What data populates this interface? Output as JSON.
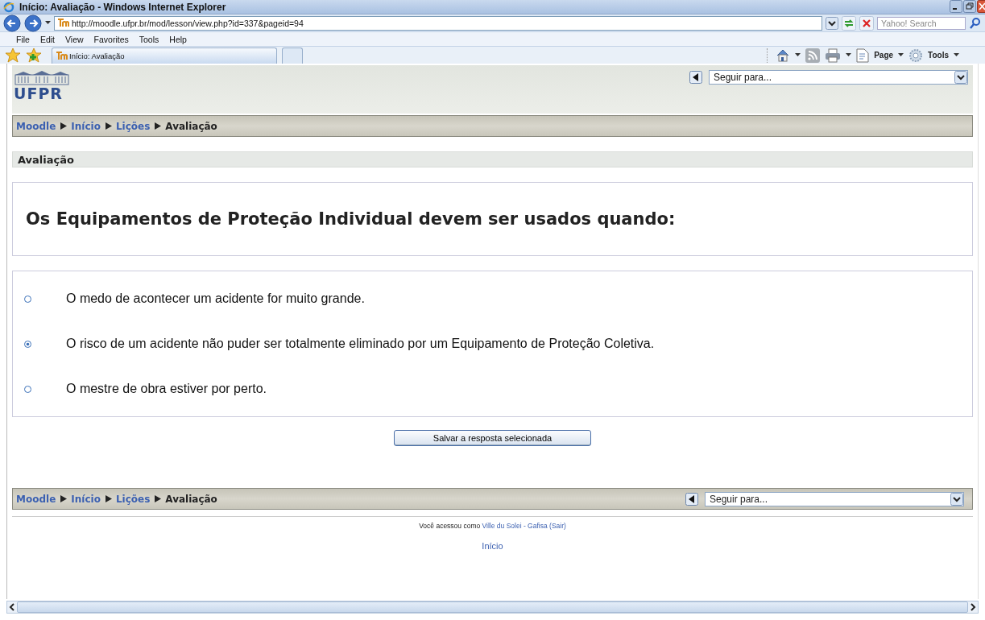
{
  "window": {
    "title": "Início: Avaliação - Windows Internet Explorer"
  },
  "address_bar": {
    "url": "http://moodle.ufpr.br/mod/lesson/view.php?id=337&pageid=94"
  },
  "search": {
    "placeholder": "Yahoo! Search"
  },
  "menu": [
    "File",
    "Edit",
    "View",
    "Favorites",
    "Tools",
    "Help"
  ],
  "tabs": [
    {
      "label": "Início: Avaliação",
      "selected": true
    }
  ],
  "command_bar": [
    "Page",
    "Tools"
  ],
  "logo": {
    "text": "UFPR"
  },
  "jump_menus": [
    {
      "placeholder": "Seguir para..."
    },
    {
      "placeholder": "Seguir para..."
    }
  ],
  "breadcrumbs": [
    [
      {
        "label": "Moodle",
        "link": true
      },
      {
        "label": "Início",
        "link": true
      },
      {
        "label": "Lições",
        "link": true
      },
      {
        "label": "Avaliação",
        "link": false
      }
    ],
    [
      {
        "label": "Moodle",
        "link": true
      },
      {
        "label": "Início",
        "link": true
      },
      {
        "label": "Lições",
        "link": true
      },
      {
        "label": "Avaliação",
        "link": false
      }
    ]
  ],
  "section_heading": "Avaliação",
  "question": "Os Equipamentos de Proteção Individual devem ser usados quando:",
  "answers": [
    {
      "text": "O medo de acontecer um acidente for muito grande.",
      "selected": false
    },
    {
      "text": "O risco de um acidente não puder ser totalmente eliminado por um Equipamento de Proteção Coletiva.",
      "selected": true
    },
    {
      "text": "O mestre de obra estiver por perto.",
      "selected": false
    }
  ],
  "submit_button": "Salvar a resposta selecionada",
  "login_info": {
    "prefix": "Você acessou como",
    "user": "Ville du Solei - Gafisa",
    "logout": "(Sair)"
  },
  "home_link": "Início"
}
